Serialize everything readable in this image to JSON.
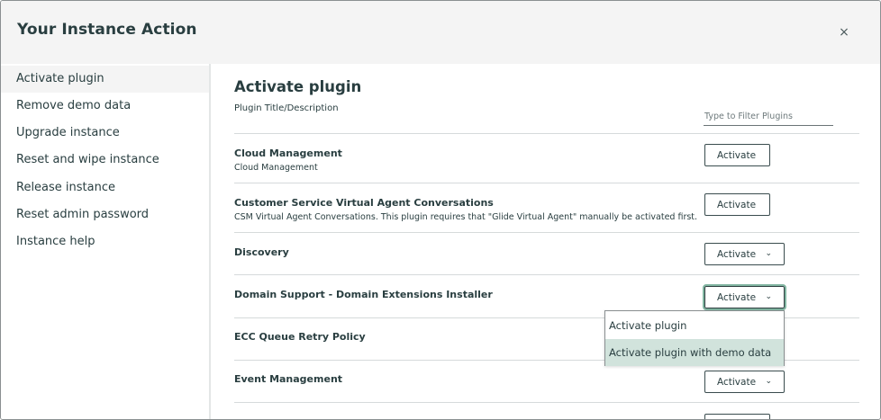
{
  "modal": {
    "title": "Your Instance Action",
    "close_icon": "×"
  },
  "sidebar": {
    "items": [
      {
        "label": "Activate plugin",
        "active": true
      },
      {
        "label": "Remove demo data"
      },
      {
        "label": "Upgrade instance"
      },
      {
        "label": "Reset and wipe instance"
      },
      {
        "label": "Release instance"
      },
      {
        "label": "Reset admin password"
      },
      {
        "label": "Instance help"
      }
    ]
  },
  "main": {
    "title": "Activate plugin",
    "column_label": "Plugin Title/Description",
    "filter_placeholder": "Type to Filter Plugins",
    "plugins": [
      {
        "title": "Cloud Management",
        "description": "Cloud Management",
        "button": "Activate"
      },
      {
        "title": "Customer Service Virtual Agent Conversations",
        "description": "CSM Virtual Agent Conversations. This plugin requires that \"Glide Virtual Agent\" manually be activated first.",
        "button": "Activate"
      },
      {
        "title": "Discovery",
        "description": "",
        "button": "Activate"
      },
      {
        "title": "Domain Support - Domain Extensions Installer",
        "description": "",
        "button": "Activate"
      },
      {
        "title": "ECC Queue Retry Policy",
        "description": "",
        "button": ""
      },
      {
        "title": "Event Management",
        "description": "",
        "button": "Activate"
      }
    ],
    "caret_icon": "⌄"
  },
  "dropdown": {
    "options": [
      "Activate plugin",
      "Activate plugin with demo data"
    ],
    "highlighted_index": 1
  },
  "colors": {
    "header_bg": "#f4f4f4",
    "text": "#293e40",
    "highlight": "#d1e3dc",
    "focus_ring": "#81b5a1"
  }
}
